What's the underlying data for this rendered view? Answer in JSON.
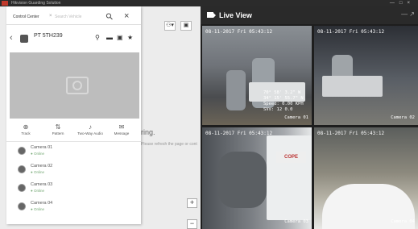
{
  "window": {
    "title": "Hikvision Guarding Solution"
  },
  "map": {
    "message": "ring.",
    "message_sub": "Please refresh the page or contact the administrator",
    "zoom_in_label": "+",
    "zoom_out_label": "−",
    "tools": [
      "⚇▾",
      "▣"
    ]
  },
  "search": {
    "scope": "Control Center",
    "separator": "×",
    "placeholder": "Search Vehicle"
  },
  "vehicle": {
    "plate": "PT 5TH239"
  },
  "actions": [
    {
      "label": "Track",
      "icon": "track-icon"
    },
    {
      "label": "Pattern",
      "icon": "pattern-icon"
    },
    {
      "label": "Two-Way Audio",
      "icon": "microphone-icon"
    },
    {
      "label": "Message",
      "icon": "message-icon"
    }
  ],
  "cameras": [
    {
      "name": "Camera 01",
      "status": "Online"
    },
    {
      "name": "Camera 02",
      "status": "Online"
    },
    {
      "name": "Camera 03",
      "status": "Online"
    },
    {
      "name": "Camera 04",
      "status": "Online"
    }
  ],
  "live": {
    "title": "Live View",
    "window_controls": "— ↗",
    "feeds": [
      {
        "stamp": "08-11-2017 Fri 05:43:12",
        "camera": "Camera 01",
        "overlay": [
          "70° 58' 3.2\" W",
          "34° 15' 55.7\" N",
          "Speed: 0.00 KPH",
          "SVs: 12 0.0"
        ]
      },
      {
        "stamp": "08-11-2017 Fri 05:43:12",
        "camera": "Camera 02"
      },
      {
        "stamp": "08-11-2017 Fri 05:43:12",
        "camera": "Camera 03",
        "sign": "COPE"
      },
      {
        "stamp": "08-11-2017 Fri 05:43:12",
        "camera": "Camera 04"
      }
    ]
  },
  "colors": {
    "status_online": "#4caf50",
    "live_bg": "#1e1e1e"
  }
}
